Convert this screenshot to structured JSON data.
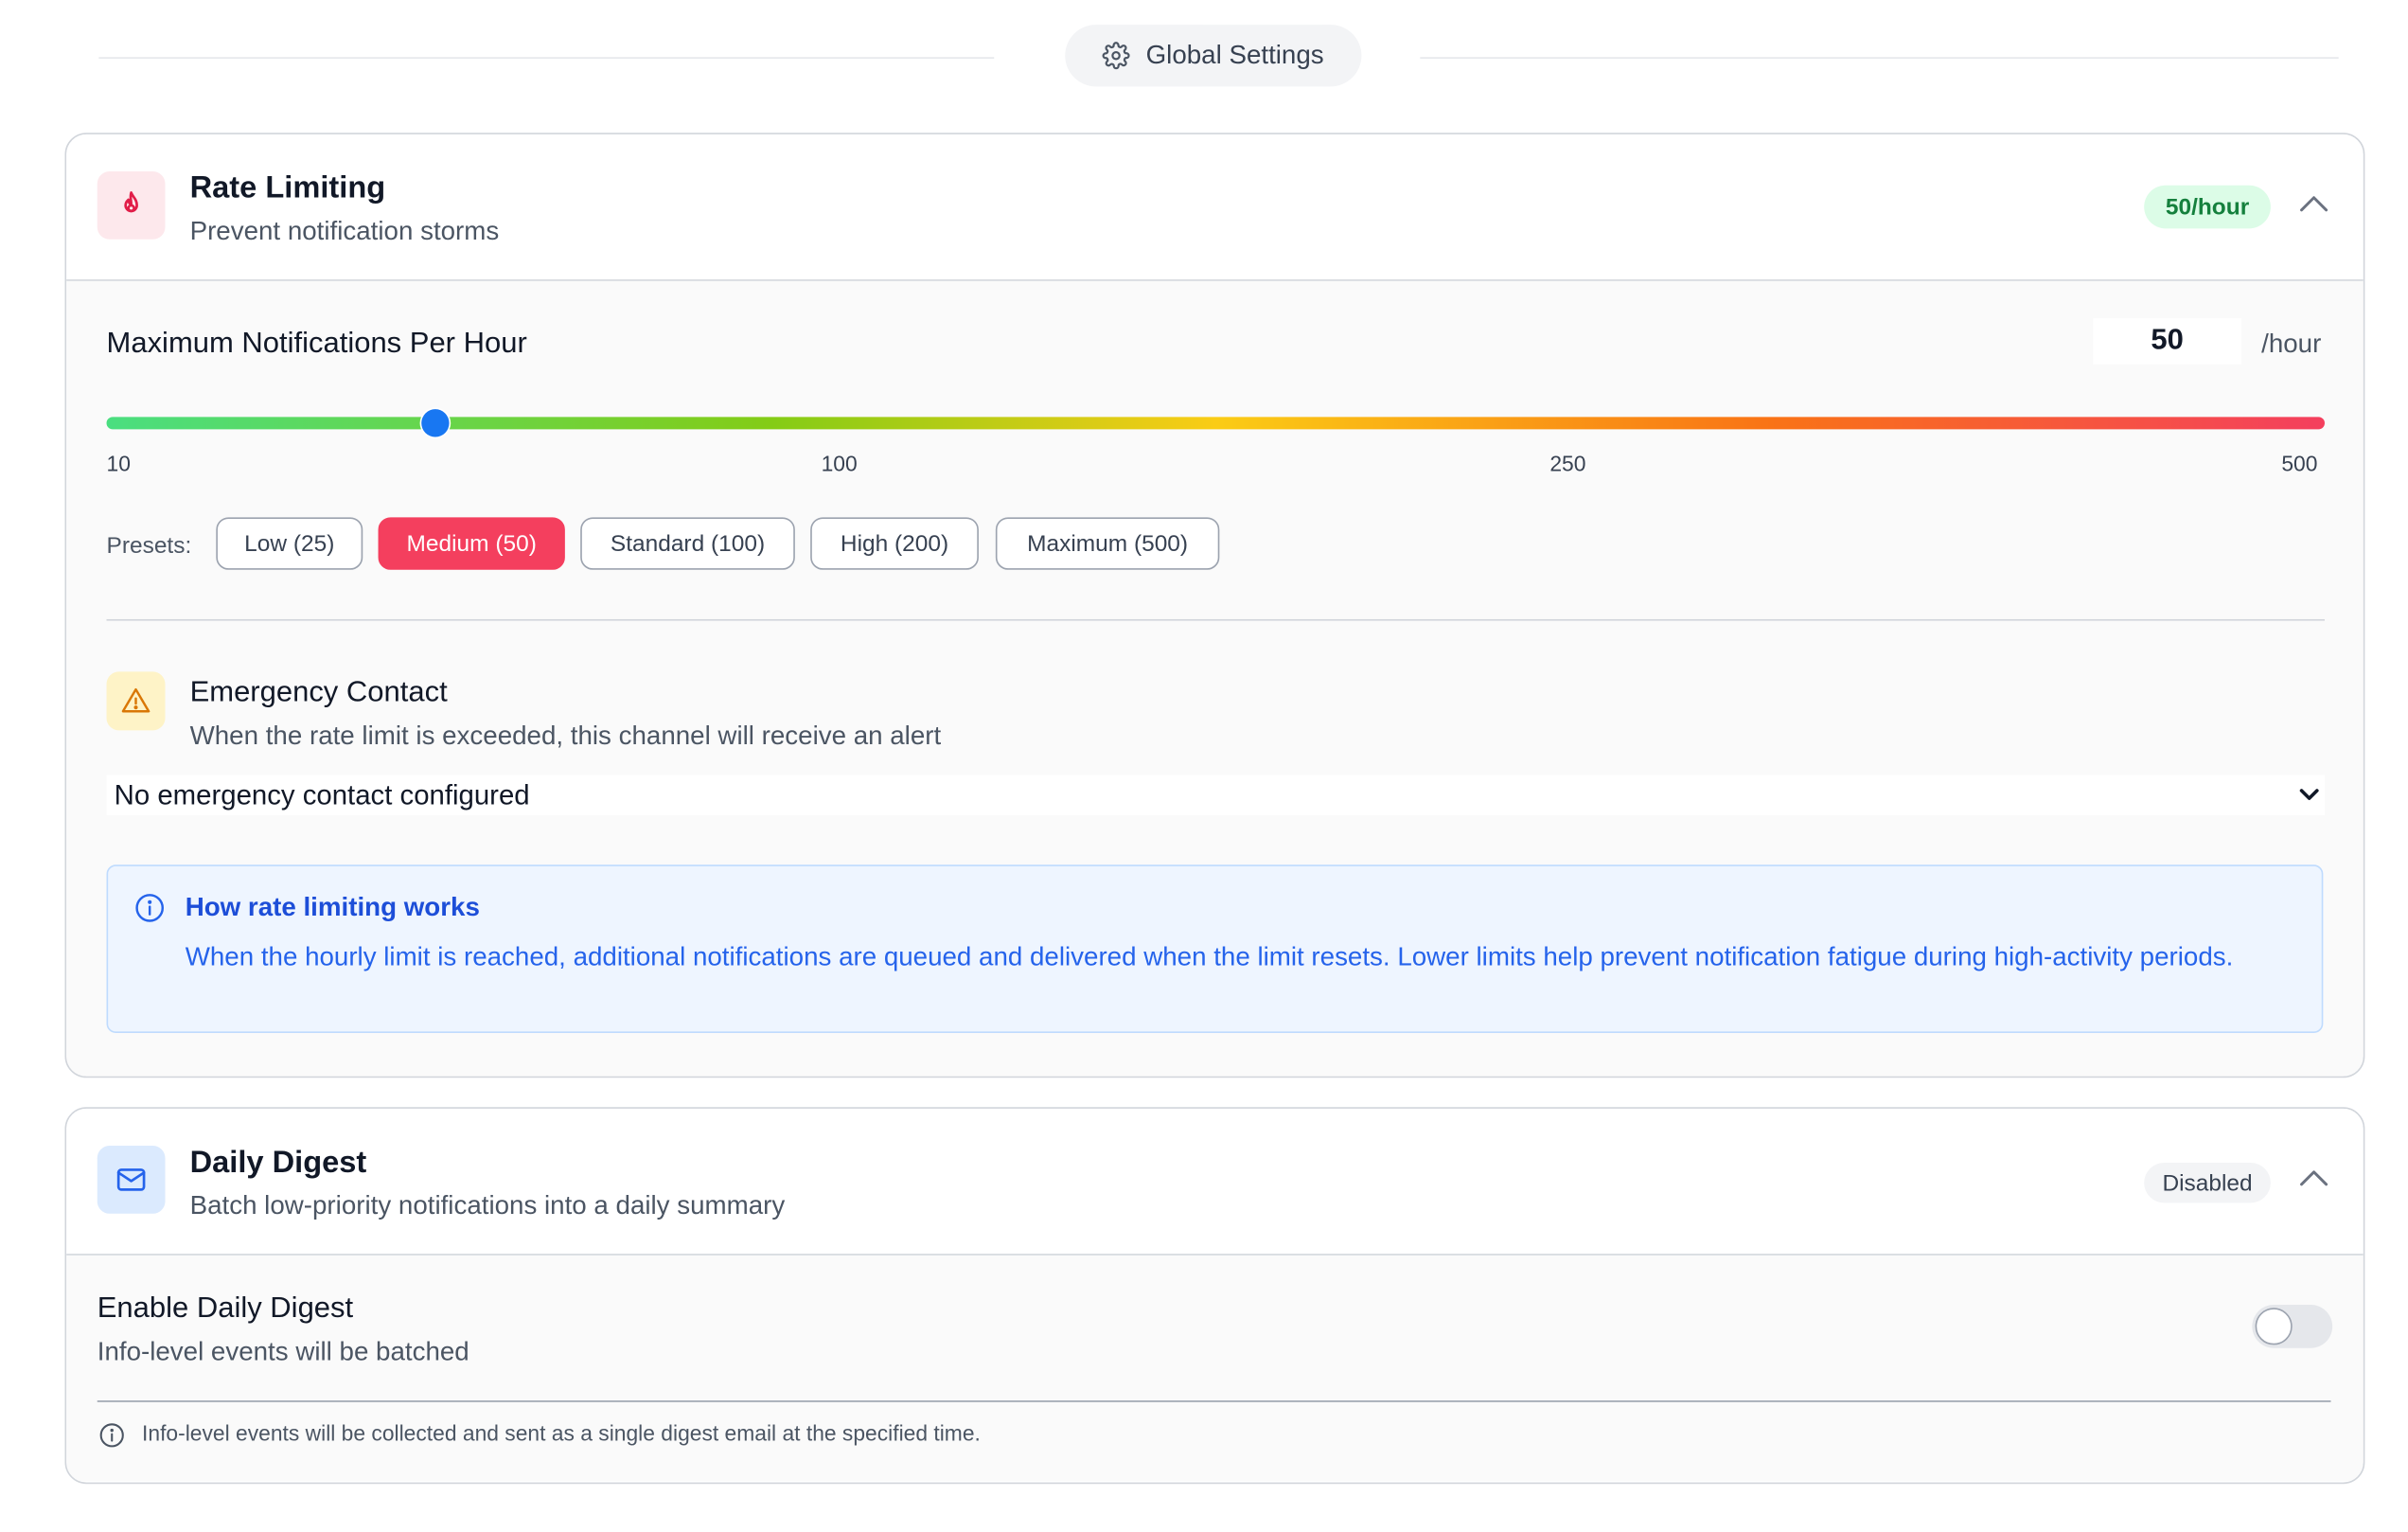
{
  "header": {
    "label": "Global Settings",
    "icon": "gear-icon"
  },
  "rate_limiting": {
    "title": "Rate Limiting",
    "subtitle": "Prevent notification storms",
    "icon": "flame-icon",
    "icon_bg": "#fde8ec",
    "badge": "50/hour",
    "badge_bg": "#dcfce7",
    "badge_color": "#15803d",
    "max_label": "Maximum Notifications Per Hour",
    "value": "50",
    "unit": "/hour",
    "slider": {
      "value": 50,
      "ticks": [
        "10",
        "100",
        "250",
        "500"
      ]
    },
    "presets_label": "Presets:",
    "presets": [
      {
        "label": "Low (25)",
        "active": false
      },
      {
        "label": "Medium (50)",
        "active": true
      },
      {
        "label": "Standard (100)",
        "active": false
      },
      {
        "label": "High (200)",
        "active": false
      },
      {
        "label": "Maximum (500)",
        "active": false
      }
    ],
    "accent_color": "#f43f5e",
    "emergency": {
      "title": "Emergency Contact",
      "subtitle": "When the rate limit is exceeded, this channel will receive an alert",
      "icon": "warning-triangle-icon",
      "select_value": "No emergency contact configured"
    },
    "info": {
      "title": "How rate limiting works",
      "text": "When the hourly limit is reached, additional notifications are queued and delivered when the limit resets. Lower limits help prevent notification fatigue during high-activity periods."
    }
  },
  "daily_digest": {
    "title": "Daily Digest",
    "subtitle": "Batch low-priority notifications into a daily summary",
    "icon": "mail-icon",
    "icon_bg": "#dbeafe",
    "badge": "Disabled",
    "enable_label": "Enable Daily Digest",
    "enable_sub": "Info-level events will be batched",
    "enabled": false,
    "note": "Info-level events will be collected and sent as a single digest email at the specified time."
  }
}
